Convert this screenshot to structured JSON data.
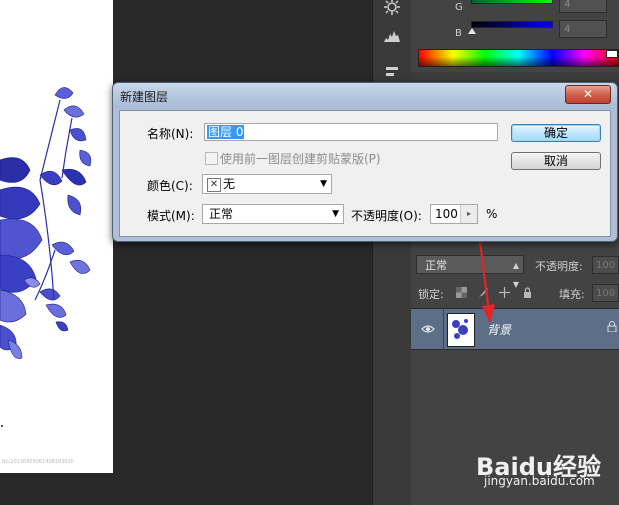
{
  "canvas": {
    "watermark_text": "No.20130905061408183020"
  },
  "color_panel": {
    "label_g": "G",
    "label_b": "B",
    "value_g": "4",
    "value_b": "4"
  },
  "dialog": {
    "title": "新建图层",
    "close_glyph": "✕",
    "name_label": "名称(N):",
    "name_value": "图层 0",
    "clip_label": "使用前一图层创建剪贴蒙版(P)",
    "color_label": "颜色(C):",
    "color_swatch_glyph": "✕",
    "color_value": "无",
    "mode_label": "模式(M):",
    "mode_value": "正常",
    "opacity_label": "不透明度(O):",
    "opacity_value": "100",
    "opacity_unit": "%",
    "ok_label": "确定",
    "cancel_label": "取消"
  },
  "layers_panel": {
    "blend_mode": "正常",
    "opacity_label": "不透明度:",
    "opacity_value": "100",
    "lock_label": "锁定:",
    "fill_label": "填充:",
    "fill_value": "100",
    "layer_name": "背景"
  },
  "site_watermark": {
    "logo_text": "Baidu经验",
    "url": "jingyan.baidu.com"
  },
  "colors": {
    "accent_blue": "#3399ff",
    "layer_selected": "#5d6f88",
    "close_button": "#d2644f"
  },
  "icons": [
    "gear-icon",
    "histogram-icon",
    "eye-icon",
    "lock-icon",
    "move-icon",
    "brush-icon",
    "checkerboard-icon",
    "dropdown-caret-icon"
  ]
}
